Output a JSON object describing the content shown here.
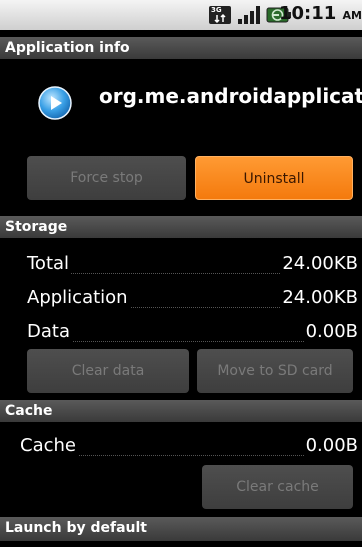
{
  "status_bar": {
    "time": "10:11",
    "ampm": "AM",
    "network_label": "3G",
    "icons": [
      "3g-data-icon",
      "signal-strength-icon",
      "battery-charging-icon"
    ]
  },
  "app_info": {
    "header": "Application info",
    "app_name": "org.me.androidapplicatio",
    "force_stop_label": "Force stop",
    "uninstall_label": "Uninstall"
  },
  "storage": {
    "header": "Storage",
    "rows": [
      {
        "label": "Total",
        "value": "24.00KB"
      },
      {
        "label": "Application",
        "value": "24.00KB"
      },
      {
        "label": "Data",
        "value": "0.00B"
      }
    ],
    "clear_data_label": "Clear data",
    "move_sd_label": "Move to SD card"
  },
  "cache": {
    "header": "Cache",
    "label": "Cache",
    "value": "0.00B",
    "clear_cache_label": "Clear cache"
  },
  "launch": {
    "header": "Launch by default"
  },
  "colors": {
    "accent_orange": "#f47a0d",
    "section_header": "#4a4a4a",
    "background": "#000000"
  }
}
